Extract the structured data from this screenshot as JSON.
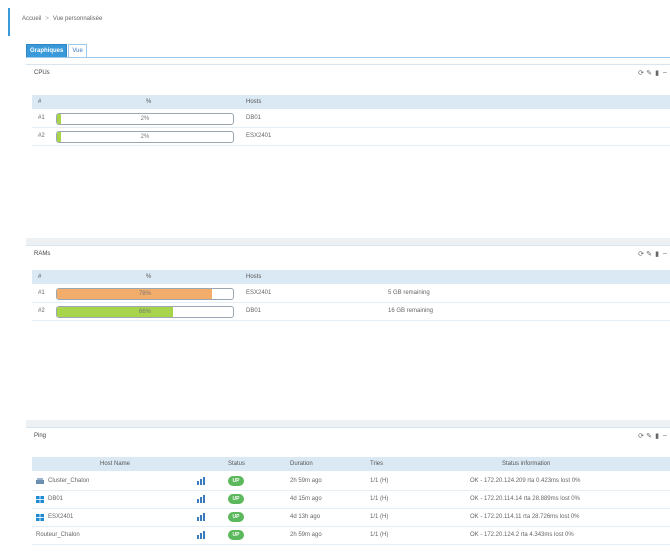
{
  "breadcrumb": {
    "root": "Accueil",
    "sep": ">",
    "current": "Vue personnalisée"
  },
  "tabs": [
    {
      "label": "Graphiques"
    },
    {
      "label": "Vue"
    }
  ],
  "cpu": {
    "title": "CPUs",
    "headers": {
      "id": "#",
      "pct": "%",
      "host": "Hosts"
    },
    "rows": [
      {
        "id": "#1",
        "pct_label": "2%",
        "value": 0.02,
        "host": "DB01"
      },
      {
        "id": "#2",
        "pct_label": "2%",
        "value": 0.02,
        "host": "ESX2401"
      }
    ]
  },
  "ram": {
    "title": "RAMs",
    "headers": {
      "id": "#",
      "pct": "%",
      "host": "Hosts"
    },
    "rows": [
      {
        "id": "#1",
        "pct_label": "78%",
        "value": 0.88,
        "host": "ESX2401",
        "extra": "5 GB remaining"
      },
      {
        "id": "#2",
        "pct_label": "66%",
        "value": 0.66,
        "host": "DB01",
        "extra": "16 GB remaining"
      }
    ]
  },
  "ping": {
    "title": "Ping",
    "headers": {
      "host": "Host Name",
      "status": "Status",
      "duration": "Duration",
      "tries": "Tries",
      "info": "Status information"
    },
    "rows": [
      {
        "host": "Cluster_Chalon",
        "status": "UP",
        "duration": "2h 59m ago",
        "tries": "1/1 (H)",
        "info": "OK - 172.20.124.209 rta 0.423ms lost 0%"
      },
      {
        "host": "DB01",
        "status": "UP",
        "duration": "4d 15m ago",
        "tries": "1/1 (H)",
        "info": "OK - 172.20.114.14 rta 28.889ms lost 0%"
      },
      {
        "host": "ESX2401",
        "status": "UP",
        "duration": "4d 13h ago",
        "tries": "1/1 (H)",
        "info": "OK - 172.20.114.11 rta 28.726ms lost 0%"
      },
      {
        "host": "Routeur_Chalon",
        "status": "UP",
        "duration": "2h 59m ago",
        "tries": "1/1 (H)",
        "info": "OK - 172.20.124.2 rta 4.343ms lost 0%"
      }
    ]
  },
  "colors": {
    "accent": "#3a9ad9",
    "up": "#5cb85c",
    "cpu_bar": "#a7d44a",
    "ram_high": "#f3ad6b",
    "ram_ok": "#a7d44a"
  }
}
